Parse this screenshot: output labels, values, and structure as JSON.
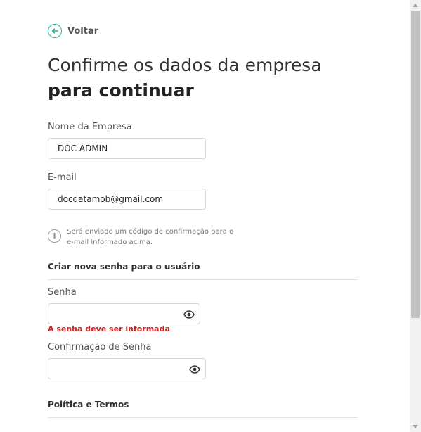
{
  "back": {
    "label": "Voltar"
  },
  "title": {
    "line1": "Confirme os dados da empresa",
    "line2": "para continuar"
  },
  "company": {
    "label": "Nome da Empresa",
    "value": "DOC ADMIN"
  },
  "email": {
    "label": "E-mail",
    "value": "docdatamob@gmail.com"
  },
  "info_note": {
    "text": "Será enviado um código de confirmação para o e-mail informado acima."
  },
  "password_section": {
    "heading": "Criar nova senha para o usuário"
  },
  "password": {
    "label": "Senha",
    "value": "",
    "error": "A senha deve ser informada"
  },
  "password_confirm": {
    "label": "Confirmação de Senha",
    "value": ""
  },
  "policy_section": {
    "heading": "Política e Termos"
  },
  "colors": {
    "accent": "#27b39a",
    "error": "#d42020"
  },
  "icons": {
    "back": "arrow-left-circle-icon",
    "info": "info-circle-icon",
    "show_password": "eye-icon"
  }
}
